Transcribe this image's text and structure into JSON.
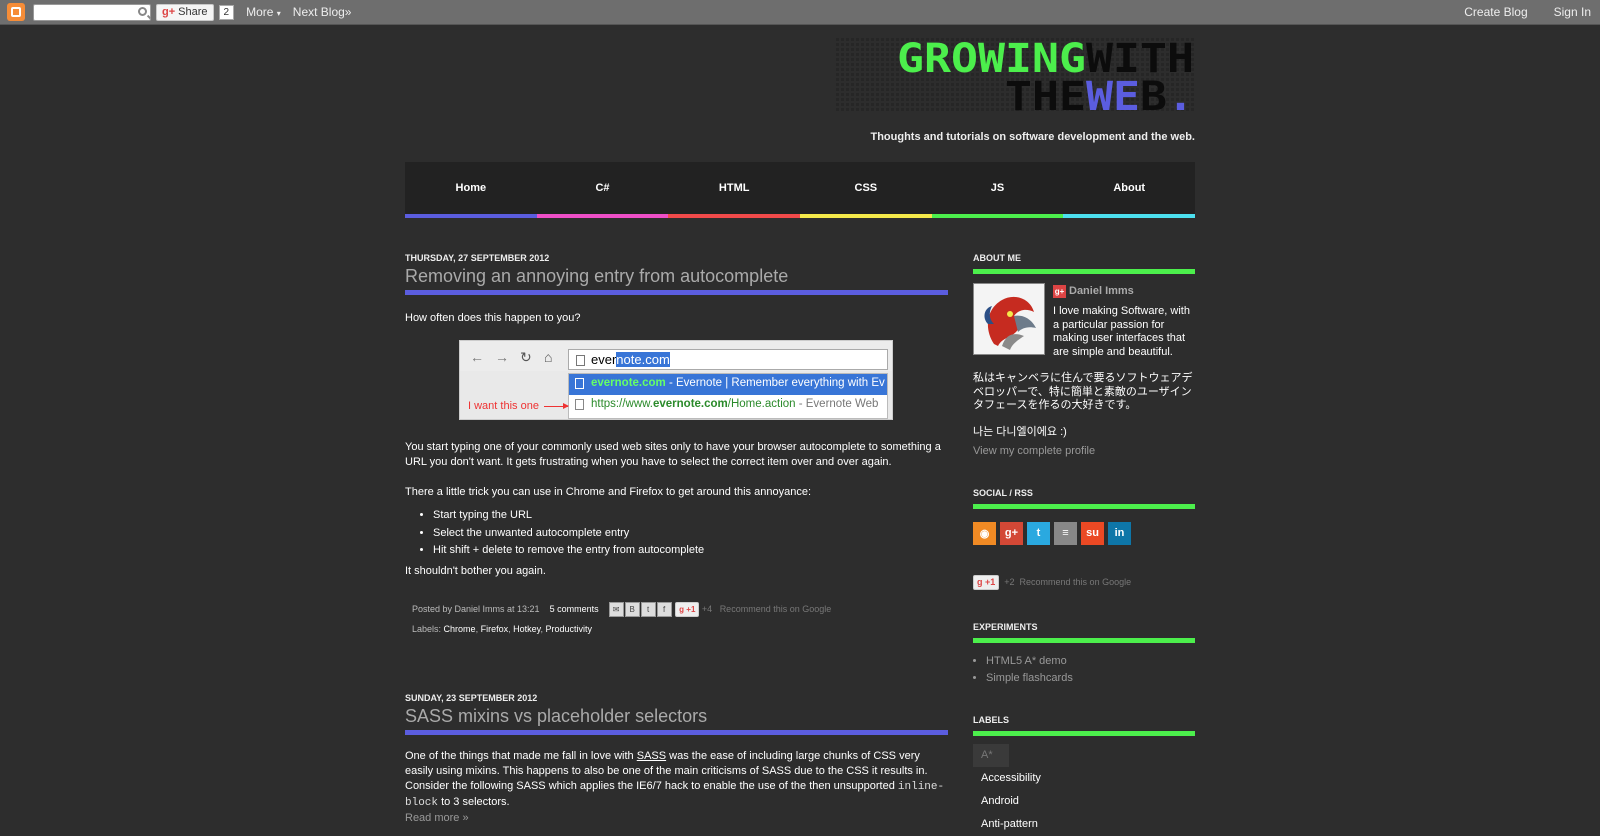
{
  "navbar": {
    "share_label": "Share",
    "share_count": "2",
    "more_label": "More",
    "next_blog_label": "Next Blog»",
    "create_blog_label": "Create Blog",
    "sign_in_label": "Sign In"
  },
  "header": {
    "title_line1": "GROWINGWITH",
    "title_line2": "THEWEB.",
    "tagline": "Thoughts and tutorials on software development and the web."
  },
  "tabs": [
    {
      "label": "Home",
      "color": "#5b5ddf"
    },
    {
      "label": "C#",
      "color": "#ee4fc7"
    },
    {
      "label": "HTML",
      "color": "#f14a4a"
    },
    {
      "label": "CSS",
      "color": "#f4e94a"
    },
    {
      "label": "JS",
      "color": "#4cef4c"
    },
    {
      "label": "About",
      "color": "#4ce0ef"
    }
  ],
  "post1": {
    "date": "THURSDAY, 27 SEPTEMBER 2012",
    "title": "Removing an annoying entry from autocomplete",
    "intro": "How often does this happen to you?",
    "screenshot": {
      "typed": "ever",
      "selected": "note.com",
      "row1_domain": "evernote.com",
      "row1_rest": " - Evernote | Remember everything with Ev",
      "row2_pre": "https://www.",
      "row2_bold": "evernote.com",
      "row2_post": "/Home.action",
      "row2_rest": " - Evernote Web",
      "note": "I want this one"
    },
    "para1": "You start typing one of your commonly used web sites only to have your browser autocomplete to something a URL you don't want. It gets frustrating when you have to select the correct item over and over again.",
    "para2": "There a little trick you can use in Chrome and Firefox to get around this annoyance:",
    "steps": [
      "Start typing the URL",
      "Select the unwanted autocomplete entry",
      "Hit shift + delete to remove the entry from autocomplete"
    ],
    "para3": "It shouldn't bother you again.",
    "footer": {
      "posted_by": "Posted by Daniel Imms at 13:21",
      "comments": "5 comments",
      "plus_one": "+1",
      "plus_count": "+4",
      "recommend": "Recommend this on Google",
      "labels_prefix": "Labels:",
      "labels": [
        "Chrome",
        "Firefox",
        "Hotkey",
        "Productivity"
      ]
    }
  },
  "post2": {
    "date": "SUNDAY, 23 SEPTEMBER 2012",
    "title": "SASS mixins vs placeholder selectors",
    "para_a": "One of the things that made me fall in love with ",
    "para_link": "SASS",
    "para_b": " was the ease of including large chunks of CSS very easily using mixins. This happens to also be one of the main criticisms of SASS due to the CSS it results in. Consider the following SASS which applies the IE6/7 hack to enable the use of the then unsupported ",
    "para_code": "inline-block",
    "para_c": " to 3 selectors.",
    "read_more": "Read more »"
  },
  "sidebar": {
    "about_title": "ABOUT ME",
    "about_name": "Daniel Imms",
    "about_text": "I love making Software, with a particular passion for making user interfaces that are simple and beautiful.",
    "about_jp": "私はキャンベラに住んで要るソフトウェアデベロッパーで、特に簡単と素敵のユーザインタフェースを作るの大好きです。",
    "about_kr": "나는 다니엘이에요 :)",
    "profile_link": "View my complete profile",
    "social_title": "SOCIAL / RSS",
    "social_icons": [
      {
        "name": "rss-icon",
        "glyph": "◉",
        "color": "#f08a24"
      },
      {
        "name": "google-plus-icon",
        "glyph": "g+",
        "color": "#d34836"
      },
      {
        "name": "twitter-icon",
        "glyph": "t",
        "color": "#2aa9e0"
      },
      {
        "name": "stackoverflow-icon",
        "glyph": "≡",
        "color": "#888888"
      },
      {
        "name": "stumbleupon-icon",
        "glyph": "su",
        "color": "#eb4924"
      },
      {
        "name": "linkedin-icon",
        "glyph": "in",
        "color": "#0e76a8"
      }
    ],
    "plus_one": "+1",
    "plus_count": "+2",
    "recommend": "Recommend this on Google",
    "experiments_title": "EXPERIMENTS",
    "experiments": [
      "HTML5 A* demo",
      "Simple flashcards"
    ],
    "labels_title": "LABELS",
    "labels": [
      "A*",
      "Accessibility",
      "Android",
      "Anti-pattern"
    ]
  }
}
